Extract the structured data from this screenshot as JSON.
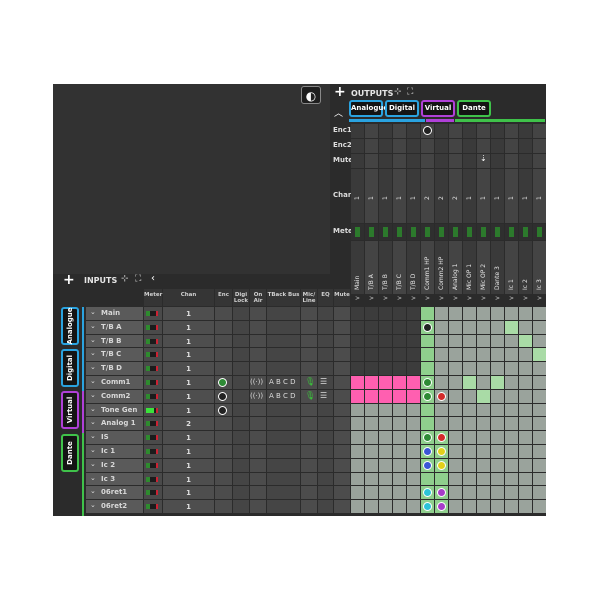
{
  "theme_toggle": "◐",
  "outputs": {
    "label": "OUTPUTS",
    "tabs": [
      {
        "label": "Analogue",
        "color": "#2aa3e0"
      },
      {
        "label": "Digital",
        "color": "#2aa3e0"
      },
      {
        "label": "Virtual",
        "color": "#b040d8"
      },
      {
        "label": "Dante",
        "color": "#3fc24a"
      }
    ],
    "row_labels": [
      "Enc1",
      "Enc2",
      "Mute",
      "Chan",
      "Meter"
    ],
    "columns": [
      "Main",
      "T/B A",
      "T/B B",
      "T/B C",
      "T/B D",
      "Comm1 HP",
      "Comm2 HP",
      "Analog 1",
      "Mic OP 1",
      "Mic OP 2",
      "Dante 3",
      "Ic 1",
      "Ic 2",
      "Ic 3"
    ],
    "chan": [
      "1",
      "1",
      "1",
      "1",
      "1",
      "2",
      "2",
      "2",
      "1",
      "1",
      "1",
      "1",
      "1",
      "1"
    ],
    "expand_glyph": ">"
  },
  "inputs": {
    "label": "INPUTS",
    "side_tabs": [
      {
        "label": "Analogue",
        "color": "#2aa3e0"
      },
      {
        "label": "Digital",
        "color": "#2aa3e0"
      },
      {
        "label": "Virtual",
        "color": "#b040d8"
      },
      {
        "label": "Dante",
        "color": "#3fc24a"
      }
    ],
    "columns": [
      "Meter",
      "Chan",
      "Enc",
      "Digi Lock",
      "On Air",
      "TBack Bus",
      "Mic/ Line",
      "EQ",
      "Mute"
    ],
    "tback_letters": "A B C D",
    "rows": [
      {
        "name": "Main",
        "chan": "1"
      },
      {
        "name": "T/B A",
        "chan": "1"
      },
      {
        "name": "T/B B",
        "chan": "1"
      },
      {
        "name": "T/B C",
        "chan": "1"
      },
      {
        "name": "T/B D",
        "chan": "1"
      },
      {
        "name": "Comm1",
        "chan": "1"
      },
      {
        "name": "Comm2",
        "chan": "1"
      },
      {
        "name": "Tone Gen",
        "chan": "1"
      },
      {
        "name": "Analog 1",
        "chan": "2"
      },
      {
        "name": "IS",
        "chan": "1"
      },
      {
        "name": "Ic 1",
        "chan": "1"
      },
      {
        "name": "Ic 2",
        "chan": "1"
      },
      {
        "name": "Ic 3",
        "chan": "1"
      },
      {
        "name": "06ret1",
        "chan": "1"
      },
      {
        "name": "06ret2",
        "chan": "1"
      }
    ]
  },
  "colors": {
    "pink": "#ff5fb0",
    "grid_dark": "#3c3c3c",
    "grid_light": "#9aa39c",
    "lit": "#a9dba6",
    "route_col": "#8fcf8d",
    "dot_green": "#2e8b35",
    "dot_red": "#d22a2a",
    "dot_blue": "#3b55d6",
    "dot_yellow": "#e3d11a",
    "dot_cyan": "#2cc3d8",
    "dot_purple": "#a73cc9"
  }
}
